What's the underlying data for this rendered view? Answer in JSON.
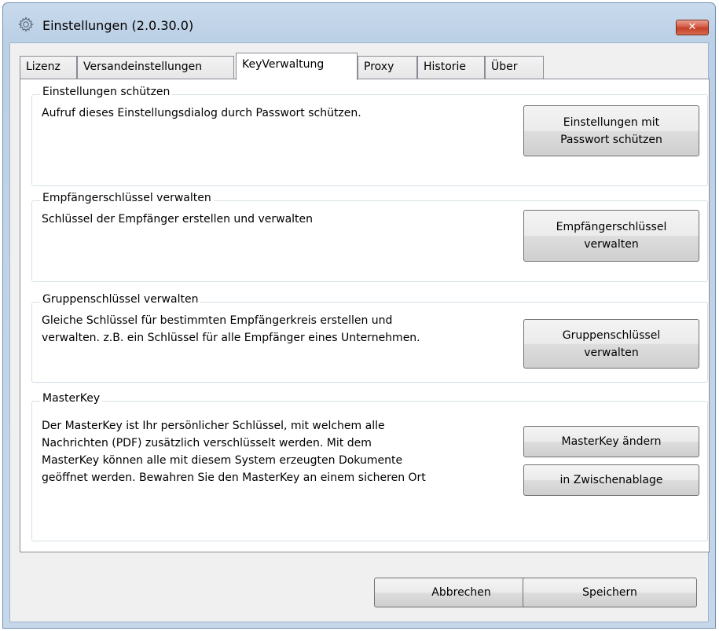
{
  "window": {
    "title": "Einstellungen (2.0.30.0)",
    "close_label": "✕",
    "icon": "gear-icon"
  },
  "tabs": [
    {
      "label": "Lizenz",
      "active": false
    },
    {
      "label": "Versandeinstellungen",
      "active": false
    },
    {
      "label": "KeyVerwaltung",
      "active": true
    },
    {
      "label": "Proxy",
      "active": false
    },
    {
      "label": "Historie",
      "active": false
    },
    {
      "label": "Über",
      "active": false
    }
  ],
  "groups": {
    "protect": {
      "title": "Einstellungen schützen",
      "description": "Aufruf dieses Einstellungsdialog durch Passwort schützen.",
      "button_line1": "Einstellungen mit",
      "button_line2": "Passwort schützen"
    },
    "recipient_keys": {
      "title": "Empfängerschlüssel verwalten",
      "description": "Schlüssel der Empfänger erstellen und verwalten",
      "button_line1": "Empfängerschlüssel",
      "button_line2": "verwalten"
    },
    "group_keys": {
      "title": "Gruppenschlüssel verwalten",
      "description_line1": "Gleiche Schlüssel für bestimmten Empfängerkreis erstellen und",
      "description_line2": "verwalten. z.B. ein Schlüssel für alle Empfänger eines Unternehmen.",
      "button_line1": "Gruppenschlüssel",
      "button_line2": "verwalten"
    },
    "masterkey": {
      "title": "MasterKey",
      "description_lines": [
        "Der MasterKey ist Ihr persönlicher Schlüssel, mit welchem alle",
        "Nachrichten (PDF) zusätzlich verschlüsselt werden. Mit dem",
        "MasterKey können alle mit diesem System erzeugten Dokumente",
        "geöffnet werden. Bewahren Sie den MasterKey an einem sicheren Ort"
      ],
      "change_button": "MasterKey ändern",
      "clipboard_button": "in Zwischenablage"
    }
  },
  "footer": {
    "cancel_label": "Abbrechen",
    "save_label": "Speichern"
  }
}
